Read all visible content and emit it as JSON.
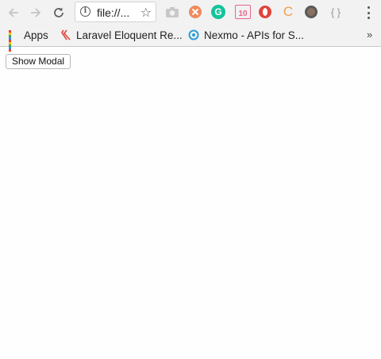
{
  "browser": {
    "address_bar": {
      "url": "file://..."
    },
    "bookmarks": [
      {
        "label": "Apps",
        "icon": "apps-grid-icon"
      },
      {
        "label": "Laravel Eloquent Re...",
        "icon": "laravel-icon"
      },
      {
        "label": "Nexmo - APIs for S...",
        "icon": "nexmo-icon"
      }
    ],
    "overflow_label": "»",
    "extensions": [
      {
        "icon": "camera-icon"
      },
      {
        "icon": "cancel-ext-icon",
        "color": "#f08a5d"
      },
      {
        "icon": "grammarly-icon",
        "color": "#15c39a",
        "glyph": "G"
      },
      {
        "icon": "calendar-icon",
        "color": "#e8658a",
        "glyph": "10"
      },
      {
        "icon": "opera-icon",
        "color": "#e0443c"
      },
      {
        "icon": "c-ext-icon",
        "color": "#f0a04b",
        "glyph": "C"
      },
      {
        "icon": "avatar-ext-icon",
        "color": "#8a7060"
      },
      {
        "icon": "braces-icon",
        "glyph": "{ }"
      }
    ]
  },
  "page": {
    "show_modal_button": "Show Modal"
  }
}
